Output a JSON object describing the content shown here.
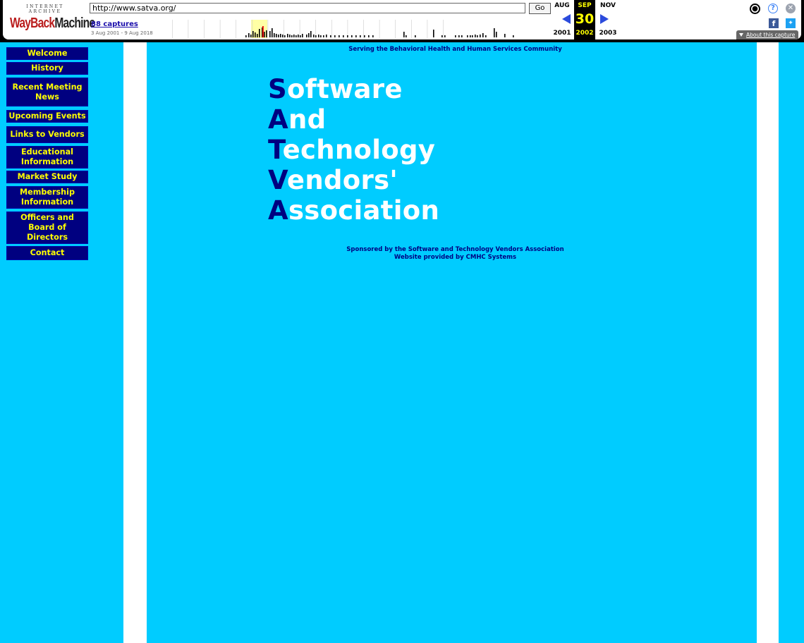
{
  "wayback": {
    "logo_top": "INTERNET ARCHIVE",
    "logo_main_1": "WayBack",
    "logo_main_2": "Machine",
    "url": "http://www.satva.org/",
    "go_label": "Go",
    "captures": "88 captures",
    "date_range": "3 Aug 2001 - 9 Aug 2018",
    "prev_month": "AUG",
    "prev_year": "2001",
    "cur_month": "SEP",
    "cur_day": "30",
    "cur_year": "2002",
    "next_month": "NOV",
    "next_year": "2003",
    "about": "About this capture",
    "icons": {
      "user": "user-icon",
      "help": "help-icon",
      "close": "close-icon",
      "facebook": "facebook-icon",
      "twitter": "twitter-icon",
      "prev": "arrow-left-icon",
      "next": "arrow-right-icon"
    },
    "colors": {
      "arrow": "#2b4bdc",
      "current_month_bg": "#000000",
      "current_month_fg": "#ffff00"
    }
  },
  "nav": [
    "Welcome",
    "History",
    "Recent Meeting News",
    "Upcoming Events",
    "Links to Vendors",
    "Educational Information",
    "Market Study",
    "Membership Information",
    "Officers and Board of Directors",
    "Contact"
  ],
  "page": {
    "tagline": "Serving the Behavioral Health and Human Services Community",
    "title_lines": [
      {
        "cap": "S",
        "rest": "oftware"
      },
      {
        "cap": "A",
        "rest": "nd"
      },
      {
        "cap": "T",
        "rest": "echnology"
      },
      {
        "cap": "V",
        "rest": "endors'"
      },
      {
        "cap": "A",
        "rest": "ssociation"
      }
    ],
    "sponsor_line_1": "Sponsored by the Software and Technology Vendors Association",
    "sponsor_line_2": "Website provided by CMHC Systems",
    "colors": {
      "background": "#00ccff",
      "nav_bg": "#000080",
      "nav_text": "#ffff00",
      "title_cap": "#000080",
      "title_text": "#ffffff"
    }
  }
}
